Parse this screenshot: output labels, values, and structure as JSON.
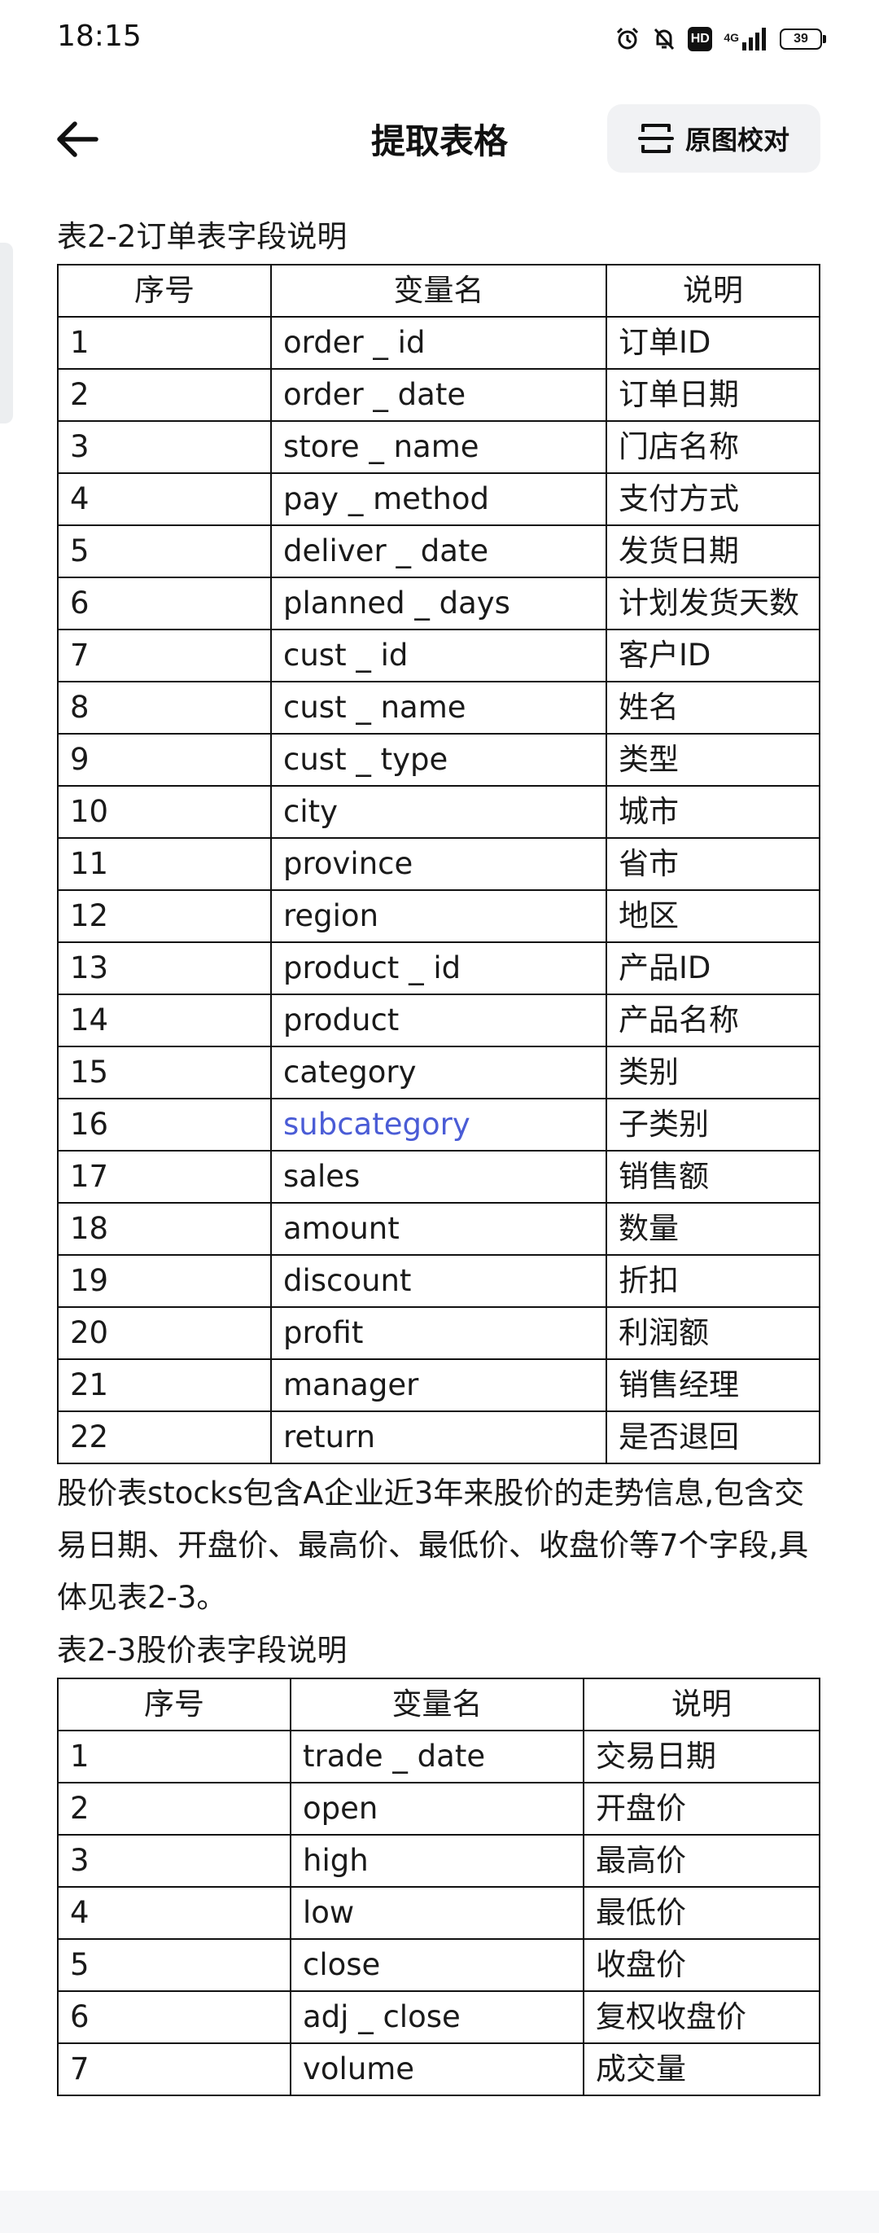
{
  "status": {
    "time": "18:15",
    "hd": "HD",
    "network": "4G",
    "battery": "39"
  },
  "header": {
    "title": "提取表格",
    "compare_label": "原图校对"
  },
  "table1": {
    "caption": "表2-2订单表字段说明",
    "headers": [
      "序号",
      "变量名",
      "说明"
    ],
    "rows": [
      [
        "1",
        "order _ id",
        "订单ID"
      ],
      [
        "2",
        "order _ date",
        "订单日期"
      ],
      [
        "3",
        "store _ name",
        "门店名称"
      ],
      [
        "4",
        "pay _ method",
        "支付方式"
      ],
      [
        "5",
        "deliver _ date",
        "发货日期"
      ],
      [
        "6",
        "planned _ days",
        "计划发货天数"
      ],
      [
        "7",
        "cust _ id",
        "客户ID"
      ],
      [
        "8",
        "cust _ name",
        "姓名"
      ],
      [
        "9",
        "cust _ type",
        "类型"
      ],
      [
        "10",
        "city",
        "城市"
      ],
      [
        "11",
        "province",
        "省市"
      ],
      [
        "12",
        "region",
        "地区"
      ],
      [
        "13",
        "product _ id",
        "产品ID"
      ],
      [
        "14",
        "product",
        "产品名称"
      ],
      [
        "15",
        "category",
        "类别"
      ],
      [
        "16",
        "subcategory",
        "子类别"
      ],
      [
        "17",
        "sales",
        "销售额"
      ],
      [
        "18",
        "amount",
        "数量"
      ],
      [
        "19",
        "discount",
        "折扣"
      ],
      [
        "20",
        "profit",
        "利润额"
      ],
      [
        "21",
        "manager",
        "销售经理"
      ],
      [
        "22",
        "return",
        "是否退回"
      ]
    ]
  },
  "paragraph": "股价表stocks包含A企业近3年来股价的走势信息,包含交易日期、开盘价、最高价、最低价、收盘价等7个字段,具体见表2-3。",
  "table2": {
    "caption": "表2-3股价表字段说明",
    "headers": [
      "序号",
      "变量名",
      "说明"
    ],
    "rows": [
      [
        "1",
        "trade _ date",
        "交易日期"
      ],
      [
        "2",
        "open",
        "开盘价"
      ],
      [
        "3",
        "high",
        "最高价"
      ],
      [
        "4",
        "low",
        "最低价"
      ],
      [
        "5",
        "close",
        "收盘价"
      ],
      [
        "6",
        "adj _ close",
        "复权收盘价"
      ],
      [
        "7",
        "volume",
        "成交量"
      ]
    ]
  },
  "colors": {
    "link": "#4a5cd6",
    "border": "#111111",
    "button_bg": "#f1f2f4"
  }
}
